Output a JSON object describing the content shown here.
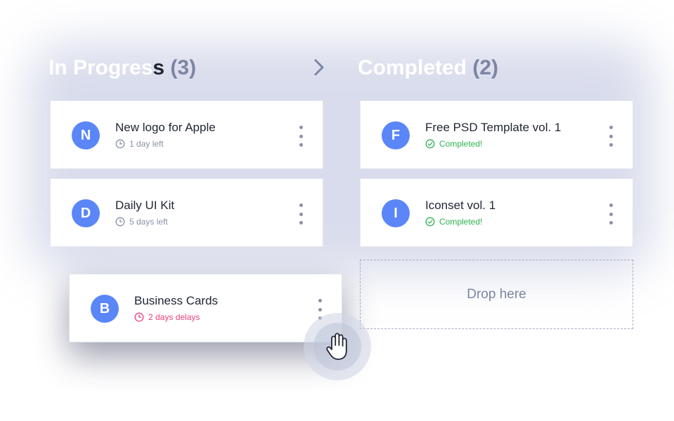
{
  "columns": [
    {
      "title_main": "In Progres",
      "title_last": "s",
      "count": "(3)"
    },
    {
      "title_main": "Completed",
      "title_last": "",
      "count": "(2)"
    }
  ],
  "in_progress_cards": [
    {
      "avatar": "N",
      "title": "New logo for Apple",
      "meta": "1 day left"
    },
    {
      "avatar": "D",
      "title": "Daily UI Kit",
      "meta": "5 days left"
    }
  ],
  "dragging_card": {
    "avatar": "B",
    "title": "Business Cards",
    "meta": "2 days delays"
  },
  "completed_cards": [
    {
      "avatar": "F",
      "title": "Free PSD Template vol. 1",
      "meta": "Completed!"
    },
    {
      "avatar": "I",
      "title": "Iconset vol. 1",
      "meta": "Completed!"
    }
  ],
  "dropzone": {
    "label": "Drop here"
  },
  "colors": {
    "avatar": "#5b86f7",
    "late": "#e8407b",
    "done": "#2fb24e",
    "muted": "#8a91a8"
  },
  "icons": {
    "next": "chevron-right-icon",
    "pending": "clock-icon",
    "late": "clock-icon",
    "done": "check-circle-icon",
    "menu": "more-vertical-icon",
    "cursor": "grab-hand-icon"
  }
}
